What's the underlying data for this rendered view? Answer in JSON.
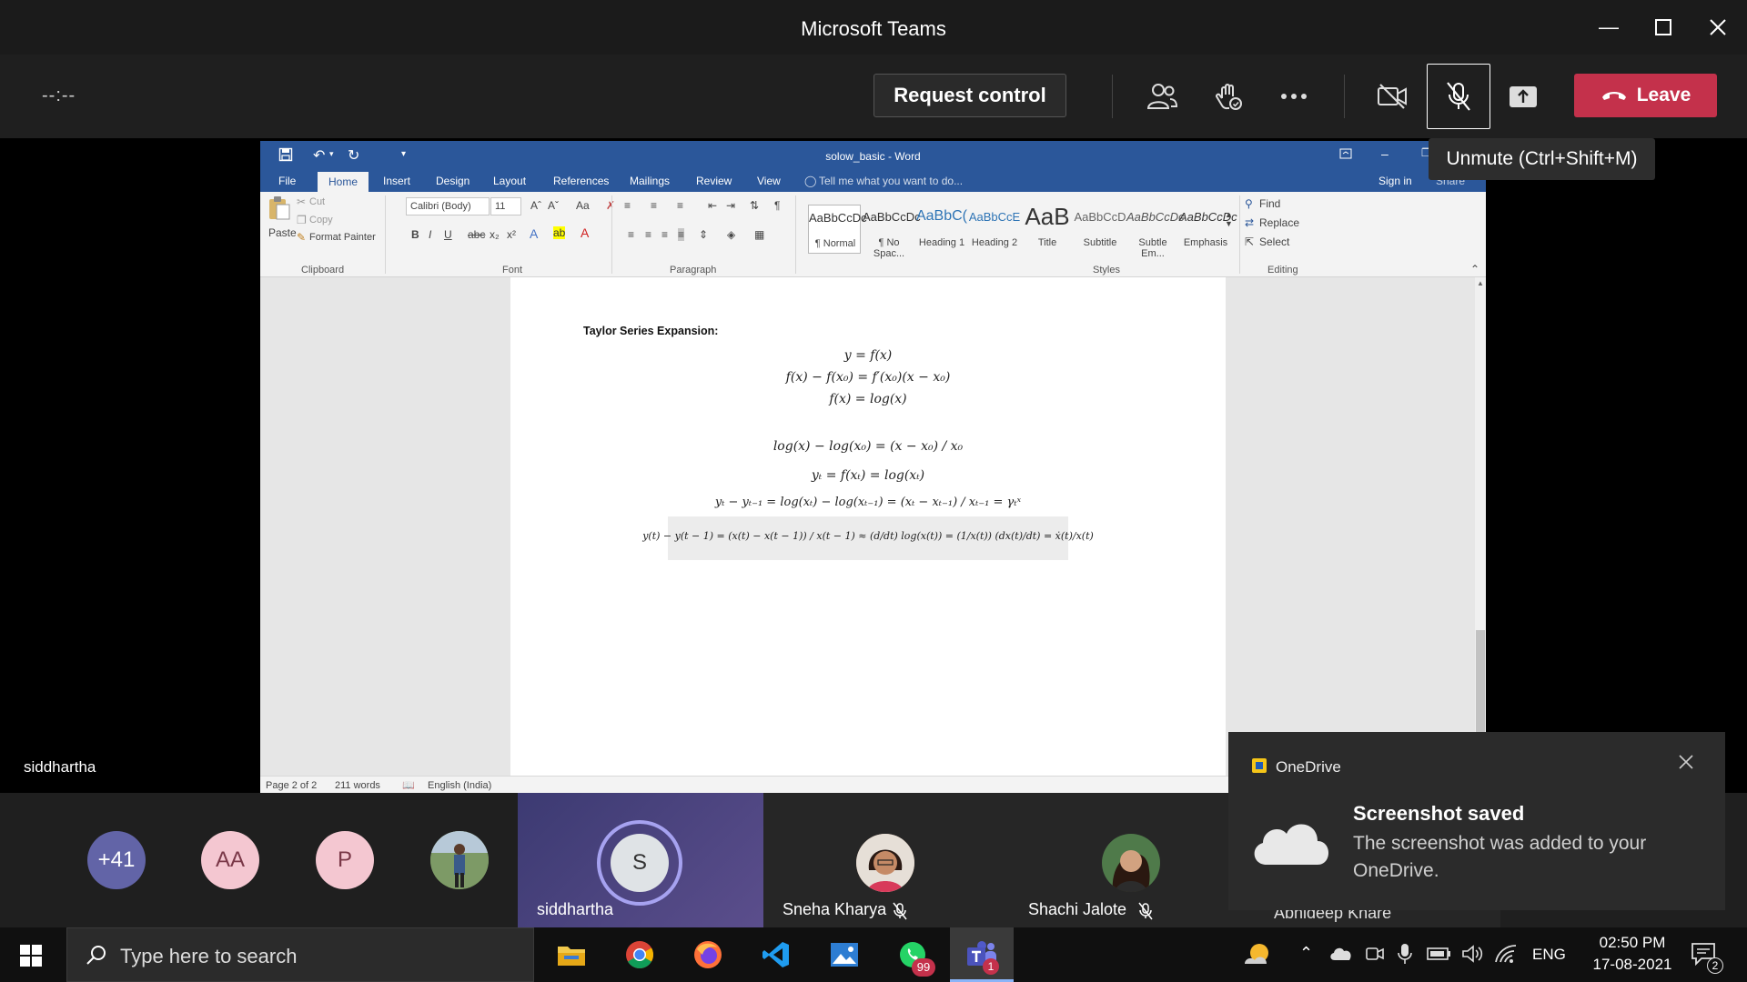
{
  "window": {
    "title": "Microsoft Teams"
  },
  "toolbar": {
    "timer": "--:--",
    "request_control_label": "Request control",
    "leave_label": "Leave",
    "mute_tooltip": "Unmute (Ctrl+Shift+M)"
  },
  "stage": {
    "presenter_name": "siddhartha"
  },
  "word": {
    "quick_access": "☰",
    "doc_title": "solow_basic - Word",
    "sign_in": "Sign in",
    "share": "Share",
    "tabs": [
      "File",
      "Home",
      "Insert",
      "Design",
      "Layout",
      "References",
      "Mailings",
      "Review",
      "View"
    ],
    "tell_me": "Tell me what you want to do...",
    "clipboard": {
      "paste": "Paste",
      "cut": "Cut",
      "copy": "Copy",
      "format_painter": "Format Painter",
      "label": "Clipboard"
    },
    "font": {
      "name": "Calibri (Body)",
      "size": "11",
      "label": "Font"
    },
    "paragraph_label": "Paragraph",
    "styles_label": "Styles",
    "styles": [
      {
        "preview": "AaBbCcDc",
        "name": "¶ Normal"
      },
      {
        "preview": "AaBbCcDc",
        "name": "¶ No Spac..."
      },
      {
        "preview": "AaBbC(",
        "name": "Heading 1"
      },
      {
        "preview": "AaBbCcE",
        "name": "Heading 2"
      },
      {
        "preview": "AaB",
        "name": "Title"
      },
      {
        "preview": "AaBbCcD",
        "name": "Subtitle"
      },
      {
        "preview": "AaBbCcDc",
        "name": "Subtle Em..."
      },
      {
        "preview": "AaBbCcDc",
        "name": "Emphasis"
      }
    ],
    "editing": {
      "find": "Find",
      "replace": "Replace",
      "select": "Select",
      "label": "Editing"
    },
    "document": {
      "heading": "Taylor Series Expansion:",
      "equations": [
        "y = f(x)",
        "f(x) − f(x₀) = f′(x₀)(x − x₀)",
        "f(x) = log(x)",
        "log(x) − log(x₀) = (x − x₀) / x₀",
        "yₜ = f(xₜ) = log(xₜ)",
        "yₜ − yₜ₋₁ = log(xₜ) − log(xₜ₋₁) = (xₜ − xₜ₋₁) / xₜ₋₁ = γₜˣ",
        "y(t) − y(t − 1) = (x(t) − x(t − 1)) / x(t − 1) ≈ (d/dt) log(x(t)) = (1/x(t)) (dx(t)/dt) = ẋ(t)/x(t)"
      ]
    },
    "status": {
      "page": "Page 2 of 2",
      "words": "211 words",
      "language": "English (India)"
    }
  },
  "toast": {
    "app": "OneDrive",
    "title": "Screenshot saved",
    "body": "The screenshot was added to your OneDrive."
  },
  "participants": {
    "overflow": "+41",
    "avatars": [
      "AA",
      "P"
    ],
    "tiles": [
      {
        "initial": "S",
        "name": "siddhartha"
      },
      {
        "name": "Sneha Kharya"
      },
      {
        "name": "Shachi Jalote"
      },
      {
        "name": "Abhideep Khare"
      }
    ]
  },
  "taskbar": {
    "search_placeholder": "Type here to search",
    "whatsapp_badge": "99",
    "teams_badge": "1",
    "language": "ENG",
    "time": "02:50 PM",
    "date": "17-08-2021",
    "notification_count": "2"
  }
}
